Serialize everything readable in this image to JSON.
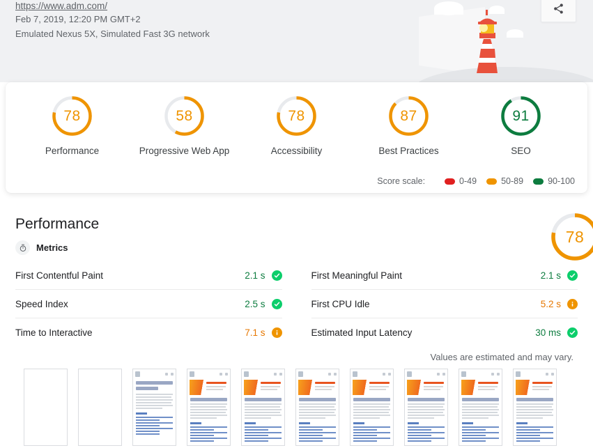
{
  "header": {
    "url": "https://www.adm.com/",
    "timestamp": "Feb 7, 2019, 12:20 PM GMT+2",
    "environment": "Emulated Nexus 5X, Simulated Fast 3G network",
    "share_icon": "share-icon",
    "lighthouse_illustration": "lighthouse-illustration"
  },
  "scores": {
    "gauges": [
      {
        "score": "78",
        "label": "Performance",
        "color": "#ef9400"
      },
      {
        "score": "58",
        "label": "Progressive Web App",
        "color": "#ef9400"
      },
      {
        "score": "78",
        "label": "Accessibility",
        "color": "#ef9400"
      },
      {
        "score": "87",
        "label": "Best Practices",
        "color": "#ef9400"
      },
      {
        "score": "91",
        "label": "SEO",
        "color": "#0d7c3f"
      }
    ],
    "scale_label": "Score scale:",
    "scale": [
      {
        "range": "0-49",
        "color": "#e02020"
      },
      {
        "range": "50-89",
        "color": "#ef9400"
      },
      {
        "range": "90-100",
        "color": "#0d7c3f"
      }
    ]
  },
  "performance": {
    "title": "Performance",
    "score": "78",
    "score_color": "#ef9400",
    "metrics_icon": "stopwatch-icon",
    "metrics_title": "Metrics",
    "disclaimer": "Values are estimated and may vary.",
    "metrics_left": [
      {
        "name": "First Contentful Paint",
        "value": "2.1 s",
        "status": "pass"
      },
      {
        "name": "Speed Index",
        "value": "2.5 s",
        "status": "pass"
      },
      {
        "name": "Time to Interactive",
        "value": "7.1 s",
        "status": "avg"
      }
    ],
    "metrics_right": [
      {
        "name": "First Meaningful Paint",
        "value": "2.1 s",
        "status": "pass"
      },
      {
        "name": "First CPU Idle",
        "value": "5.2 s",
        "status": "avg"
      },
      {
        "name": "Estimated Input Latency",
        "value": "30 ms",
        "status": "pass"
      }
    ]
  },
  "filmstrip": {
    "frames": [
      {
        "state": "blank"
      },
      {
        "state": "blank"
      },
      {
        "state": "text"
      },
      {
        "state": "full"
      },
      {
        "state": "full"
      },
      {
        "state": "full"
      },
      {
        "state": "full"
      },
      {
        "state": "full"
      },
      {
        "state": "full"
      },
      {
        "state": "full"
      }
    ]
  }
}
